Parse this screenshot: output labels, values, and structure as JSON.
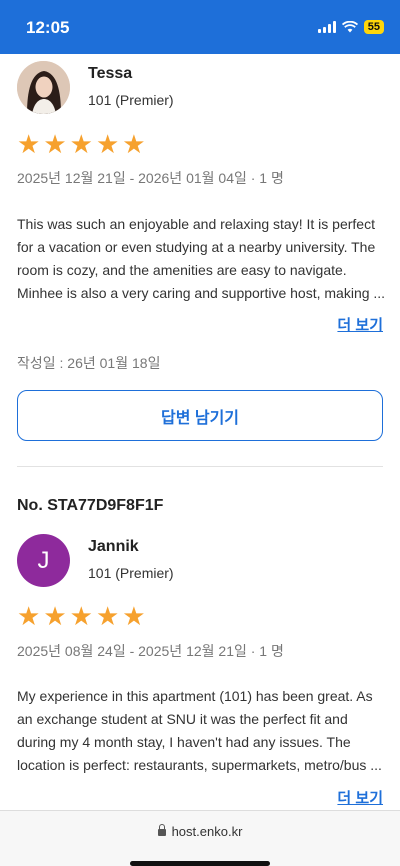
{
  "status_bar": {
    "time": "12:05",
    "battery": "55"
  },
  "reviews": [
    {
      "booking_no": "",
      "reviewer": "Tessa",
      "avatar_letter": "",
      "room": "101 (Premier)",
      "stars": [
        "★",
        "★",
        "★",
        "★",
        "★"
      ],
      "rating": 5,
      "stay": "2025년 12월 21일 - 2026년 01월 04일 · 1 명",
      "text": "This was such an enjoyable and relaxing stay! It is perfect for a vacation or even studying at a nearby university. The room is cozy, and the amenities are easy to navigate. Minhee is also a very caring and supportive host, making ...",
      "more_label": "더 보기",
      "written": "작성일 : 26년 01월 18일",
      "reply_label": "답변 남기기"
    },
    {
      "booking_no": "No. STA77D9F8F1F",
      "reviewer": "Jannik",
      "avatar_letter": "J",
      "room": "101 (Premier)",
      "stars": [
        "★",
        "★",
        "★",
        "★",
        "★"
      ],
      "rating": 5,
      "stay": "2025년 08월 24일 - 2025년 12월 21일 · 1 명",
      "text": "My experience in this apartment (101) has been great. As an exchange student at SNU it was the perfect fit and during my 4 month stay, I haven't had any issues. The location is perfect: restaurants, supermarkets, metro/bus ...",
      "more_label": "더 보기"
    }
  ],
  "browser": {
    "url": "host.enko.kr"
  },
  "colors": {
    "accent": "#1e6fd9",
    "star": "#f6a12e",
    "avatar_j": "#8e2a9c"
  }
}
